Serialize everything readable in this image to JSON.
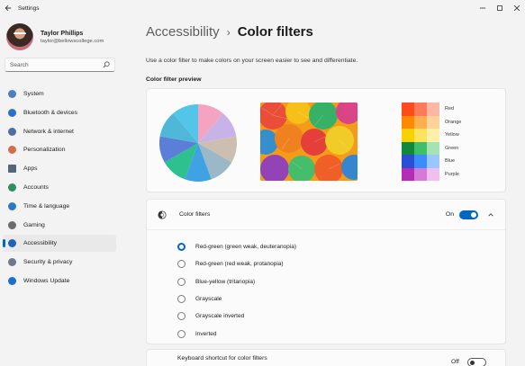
{
  "window": {
    "title": "Settings"
  },
  "profile": {
    "name": "Taylor Phillips",
    "email": "taylor@bellowscollege.com"
  },
  "search": {
    "placeholder": "Search"
  },
  "sidebar": {
    "items": [
      {
        "label": "System",
        "icon": "monitor-icon",
        "color": "#4a7fc1"
      },
      {
        "label": "Bluetooth & devices",
        "icon": "bluetooth-icon",
        "color": "#2d6fd1"
      },
      {
        "label": "Network & internet",
        "icon": "wifi-icon",
        "color": "#4b6ea3"
      },
      {
        "label": "Personalization",
        "icon": "brush-icon",
        "color": "#d0704a"
      },
      {
        "label": "Apps",
        "icon": "apps-icon",
        "color": "#55657a"
      },
      {
        "label": "Accounts",
        "icon": "person-icon",
        "color": "#2f8f5a"
      },
      {
        "label": "Time & language",
        "icon": "globe-clock-icon",
        "color": "#2d77c7"
      },
      {
        "label": "Gaming",
        "icon": "gamepad-icon",
        "color": "#6d6d6d"
      },
      {
        "label": "Accessibility",
        "icon": "accessibility-icon",
        "color": "#1e63b8",
        "active": true
      },
      {
        "label": "Security & privacy",
        "icon": "shield-icon",
        "color": "#6b7a8c"
      },
      {
        "label": "Windows Update",
        "icon": "update-icon",
        "color": "#1a6fd1"
      }
    ]
  },
  "breadcrumb": {
    "parent": "Accessibility",
    "separator": "›",
    "current": "Color filters"
  },
  "description": "Use a color filter to make colors on your screen easier to see and differentiate.",
  "preview": {
    "label": "Color filter preview",
    "pie_colors": [
      "#f4a3c0",
      "#c7b3e8",
      "#cdbfb0",
      "#9ab8c8",
      "#3fa3e3",
      "#2ec08f",
      "#5b7fd9",
      "#4fb8d8",
      "#52c5e8"
    ],
    "swatches": [
      {
        "label": "Red",
        "colors": [
          "#ff4a1c",
          "#ff7a5a",
          "#ffb7a3"
        ]
      },
      {
        "label": "Orange",
        "colors": [
          "#ff8a00",
          "#ffb04d",
          "#ffd29a"
        ]
      },
      {
        "label": "Yellow",
        "colors": [
          "#f7d100",
          "#fbe35b",
          "#fdf0a8"
        ]
      },
      {
        "label": "Green",
        "colors": [
          "#108a3a",
          "#3fbf6a",
          "#a6e3b3"
        ]
      },
      {
        "label": "Blue",
        "colors": [
          "#2a4fd6",
          "#3a8cff",
          "#9ac7ff"
        ]
      },
      {
        "label": "Purple",
        "colors": [
          "#b52cb5",
          "#d77ad7",
          "#efc0ef"
        ]
      }
    ]
  },
  "filters": {
    "title": "Color filters",
    "state": "On",
    "options": [
      {
        "label": "Red-green (green weak, deuteranopia)",
        "checked": true
      },
      {
        "label": "Red-green (red weak, protanopia)",
        "checked": false
      },
      {
        "label": "Blue-yellow (tritanopia)",
        "checked": false
      },
      {
        "label": "Grayscale",
        "checked": false
      },
      {
        "label": "Grayscale inverted",
        "checked": false
      },
      {
        "label": "Inverted",
        "checked": false
      }
    ]
  },
  "shortcut": {
    "title": "Keyboard shortcut for color filters",
    "state": "Off"
  },
  "colors": {
    "accent": "#0067c0"
  }
}
